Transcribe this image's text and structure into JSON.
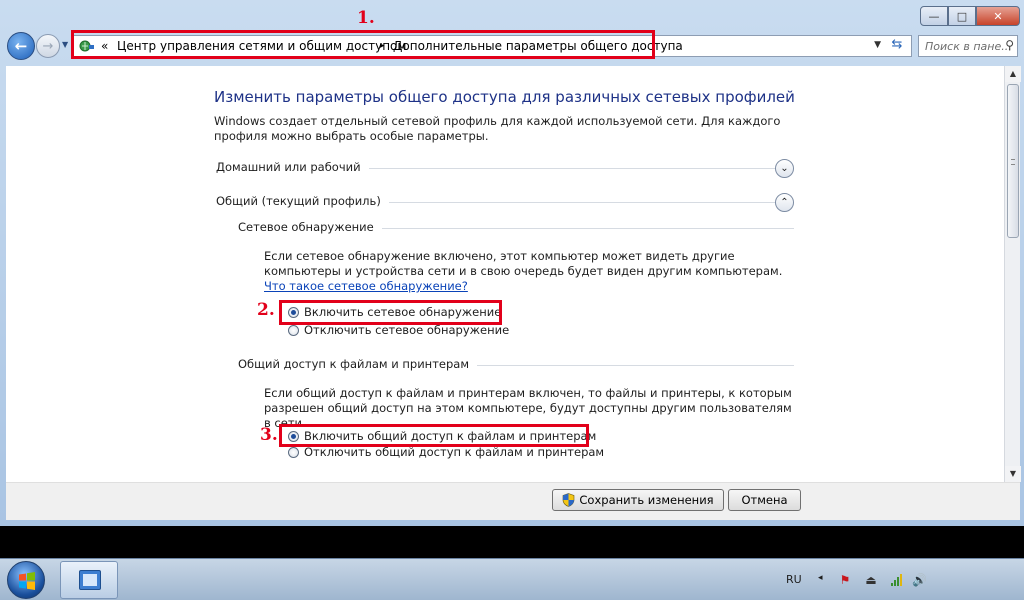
{
  "window": {
    "minimize": "—",
    "maximize": "□",
    "close": "✕"
  },
  "nav": {
    "back": "←",
    "forward": "→",
    "chevrons": "«",
    "crumb1": "Центр управления сетями и общим доступом",
    "separator": "▸",
    "crumb2": "Дополнительные параметры общего доступа",
    "search_placeholder": "Поиск в пане..."
  },
  "annotations": {
    "one": "1.",
    "two": "2.",
    "three": "3."
  },
  "main": {
    "title": "Изменить параметры общего доступа для различных сетевых профилей",
    "intro": "Windows создает отдельный сетевой профиль для каждой используемой сети. Для каждого профиля можно выбрать особые параметры.",
    "profile_home": "Домашний или рабочий",
    "profile_public": "Общий (текущий профиль)",
    "discovery": {
      "heading": "Сетевое обнаружение",
      "description": "Если сетевое обнаружение включено, этот компьютер может видеть другие компьютеры и устройства сети и в свою очередь будет виден другим компьютерам.",
      "link": "Что такое сетевое обнаружение?",
      "option_on": "Включить сетевое обнаружение",
      "option_off": "Отключить сетевое обнаружение"
    },
    "sharing": {
      "heading": "Общий доступ к файлам и принтерам",
      "description": "Если общий доступ к файлам и принтерам включен, то файлы и принтеры, к которым разрешен общий доступ на этом компьютере, будут доступны другим пользователям в сети.",
      "option_on": "Включить общий доступ к файлам и принтерам",
      "option_off": "Отключить общий доступ к файлам и принтерам"
    }
  },
  "buttons": {
    "save": "Сохранить изменения",
    "cancel": "Отмена"
  },
  "taskbar": {
    "language": "RU",
    "tray_arrow": "◂"
  },
  "colors": {
    "annotation": "#e2001a",
    "title": "#1e3287",
    "link": "#0a43b8"
  }
}
